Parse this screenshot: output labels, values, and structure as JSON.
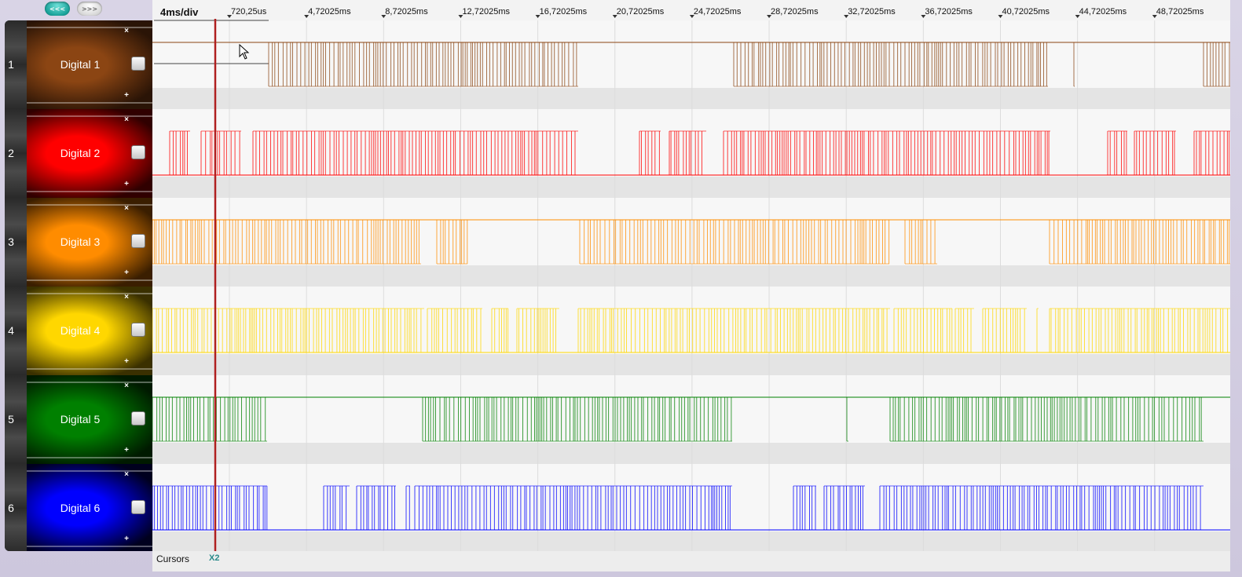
{
  "nav": {
    "back_label": "<<<",
    "forward_label": ">>>"
  },
  "timescale": "4ms/div",
  "time_ticks": [
    "720,25us",
    "4,72025ms",
    "8,72025ms",
    "12,72025ms",
    "16,72025ms",
    "20,72025ms",
    "24,72025ms",
    "28,72025ms",
    "32,72025ms",
    "36,72025ms",
    "40,72025ms",
    "44,72025ms",
    "48,72025ms"
  ],
  "channels": [
    {
      "index": "1",
      "label": "Digital 1",
      "color": "#8b4513",
      "dark": "#2a1406",
      "idle": "high",
      "close_glyph": "×",
      "add_glyph": "+"
    },
    {
      "index": "2",
      "label": "Digital 2",
      "color": "#ff0000",
      "dark": "#300000",
      "idle": "low",
      "close_glyph": "×",
      "add_glyph": "+"
    },
    {
      "index": "3",
      "label": "Digital 3",
      "color": "#ff8c00",
      "dark": "#3a1e00",
      "idle": "high",
      "close_glyph": "×",
      "add_glyph": "+"
    },
    {
      "index": "4",
      "label": "Digital 4",
      "color": "#ffd700",
      "dark": "#3a3000",
      "idle": "low",
      "close_glyph": "×",
      "add_glyph": "+"
    },
    {
      "index": "5",
      "label": "Digital 5",
      "color": "#008000",
      "dark": "#001a00",
      "idle": "high",
      "close_glyph": "×",
      "add_glyph": "+"
    },
    {
      "index": "6",
      "label": "Digital 6",
      "color": "#0000ff",
      "dark": "#00001e",
      "idle": "low",
      "close_glyph": "×",
      "add_glyph": "+"
    }
  ],
  "cursors": {
    "label": "Cursors",
    "tag": "X2"
  }
}
